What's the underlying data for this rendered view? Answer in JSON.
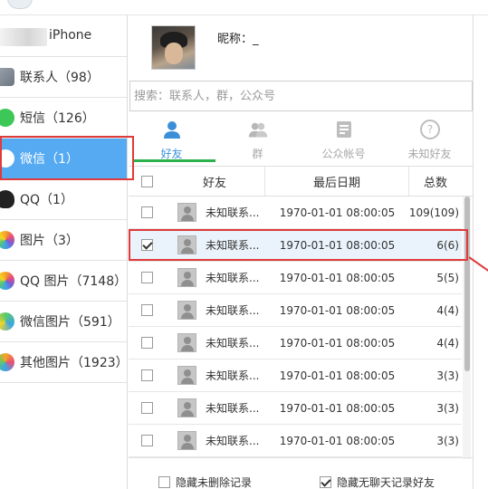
{
  "device": {
    "name": "iPhone"
  },
  "sidebar": {
    "items": [
      {
        "label": "联系人（98）",
        "icon": "contacts-icon"
      },
      {
        "label": "短信（126）",
        "icon": "sms-icon"
      },
      {
        "label": "微信（1）",
        "icon": "wechat-icon",
        "active": true
      },
      {
        "label": "QQ（1）",
        "icon": "qq-icon"
      },
      {
        "label": "图片（3）",
        "icon": "photos-icon"
      },
      {
        "label": "QQ 图片（7148）",
        "icon": "qq-photos-icon"
      },
      {
        "label": "微信图片（591）",
        "icon": "wechat-photos-icon"
      },
      {
        "label": "其他图片（1923）",
        "icon": "other-photos-icon"
      }
    ]
  },
  "profile": {
    "nickname_label": "昵称：_"
  },
  "search": {
    "placeholder": "搜索：联系人，群，公众号"
  },
  "tabs": [
    {
      "label": "好友",
      "icon": "person-icon",
      "active": true
    },
    {
      "label": "群",
      "icon": "group-icon"
    },
    {
      "label": "公众帐号",
      "icon": "official-account-icon"
    },
    {
      "label": "未知好友",
      "icon": "unknown-friend-icon"
    }
  ],
  "table": {
    "headers": {
      "friend": "好友",
      "last_date": "最后日期",
      "total": "总数"
    },
    "rows": [
      {
        "name": "未知联系...",
        "date": "1970-01-01 08:00:05",
        "total": "109(109)",
        "checked": false
      },
      {
        "name": "未知联系...",
        "date": "1970-01-01 08:00:05",
        "total": "6(6)",
        "checked": true
      },
      {
        "name": "未知联系...",
        "date": "1970-01-01 08:00:05",
        "total": "5(5)",
        "checked": false
      },
      {
        "name": "未知联系...",
        "date": "1970-01-01 08:00:05",
        "total": "4(4)",
        "checked": false
      },
      {
        "name": "未知联系...",
        "date": "1970-01-01 08:00:05",
        "total": "4(4)",
        "checked": false
      },
      {
        "name": "未知联系...",
        "date": "1970-01-01 08:00:05",
        "total": "3(3)",
        "checked": false
      },
      {
        "name": "未知联系...",
        "date": "1970-01-01 08:00:05",
        "total": "3(3)",
        "checked": false
      },
      {
        "name": "未知联系...",
        "date": "1970-01-01 08:00:05",
        "total": "3(3)",
        "checked": false
      }
    ]
  },
  "footer": {
    "hide_undeleted": {
      "label": "隐藏未删除记录",
      "checked": false
    },
    "hide_no_chat": {
      "label": "隐藏无聊天记录好友",
      "checked": true
    }
  },
  "colors": {
    "accent": "#55aaf2",
    "highlight": "#e03a3a",
    "tab_active": "#3b8fd8",
    "indicator": "#2bb24c"
  }
}
